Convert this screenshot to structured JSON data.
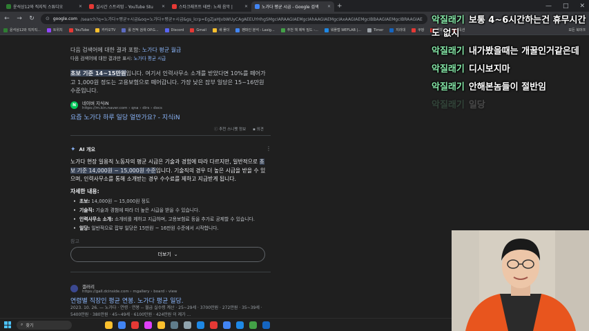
{
  "tabs": [
    {
      "label": "윤석상12와 직지직 스튜디오",
      "color": "#2e7d32",
      "active": false
    },
    {
      "label": "실시간 스트리밍 - YouTube Stu",
      "color": "#e53935",
      "active": false
    },
    {
      "label": "스타크래프트 테란: 노래 음악 |",
      "color": "#e53935",
      "active": false
    },
    {
      "label": "노가다 평균 시급 - Google 검색",
      "color": "#4285f4",
      "active": true
    }
  ],
  "toolbar": {
    "host": "google.com",
    "path": "/search?q=노가다+평균+시급&oq=노가다+평균+시급&gs_lcrp=EgZjaHJvbWUyCAgAEEUYHhgSMgcIARAAGIAEMgcIAhAAGIAEMgcIAxAAGIAEMgcIBBAAGIAEMgcIBRAAGIAEMgcIBhAAGIAEMgcIBxAAGIAE"
  },
  "bookmarks": [
    {
      "label": "윤석상12와 직지직...",
      "color": "#2e7d32"
    },
    {
      "label": "트위치",
      "color": "#9146ff"
    },
    {
      "label": "YouTube",
      "color": "#e53935"
    },
    {
      "label": "카카오TV",
      "color": "#fbc02d"
    },
    {
      "label": "롤 전적 검색 OP.G...",
      "color": "#5c6bc0"
    },
    {
      "label": "Discord",
      "color": "#5865f2"
    },
    {
      "label": "Gmail",
      "color": "#e53935"
    },
    {
      "label": "새 폴더",
      "color": "#fbc02d"
    },
    {
      "label": "팬파인 분석 - Lasig...",
      "color": "#4285f4"
    },
    {
      "label": "추천 책 제작 빌드 -...",
      "color": "#43a047"
    },
    {
      "label": "워플랩 WEFLAB |...",
      "color": "#1e88e5"
    },
    {
      "label": "Timer",
      "color": "#9aa0a6"
    },
    {
      "label": "지라대",
      "color": "#1565c0"
    },
    {
      "label": "쿠팡",
      "color": "#e53935"
    },
    {
      "label": "롯데온",
      "color": "#e53935"
    },
    {
      "label": "옥션",
      "color": "#e53935"
    }
  ],
  "bookmarks_all": "모든 북마크",
  "results": {
    "correction_prefix": "다음 검색어에 대한 결과 포함:",
    "correction_query": "노가다 평균 월급",
    "original_prefix": "다음 검색어에 대한 결과만 표시:",
    "original_query": "노가다 평균 시급",
    "snippet": {
      "highlight": "초보 기준 14~15만원",
      "text": "입니다. 여기서 인력사무소 소개를 받았다면 10%를 떼어가고 1,000원 정도는 고용보험으로 떼어갑니다. 가장 낮은 잡부 일당은 15~16만원 수준입니다."
    },
    "source_name": "네이버 지식iN",
    "source_url": "https://m.kin.naver.com › qna › dirs › docs",
    "result_title": "요즘 노가다 하루 일당 얼만가요? - 지식iN",
    "feedback_1": "추천 스니펫 정보",
    "feedback_2": "의견",
    "ai_label": "AI 개요",
    "ai_text_1": "노가다 현장 일용직 노동자의 평균 시급은 기술과 경험에 따라 다르지만, 일반적으로",
    "ai_highlight": "초보 기준 14,000원 ~ 15,000원 수준",
    "ai_text_2": "입니다. 기술직의 경우 더 높은 시급을 받을 수 있으며, 인력사무소를 통해 소개받는 경우 수수료를 제하고 지급받게 됩니다.",
    "details_title": "자세한 내용:",
    "details": [
      {
        "label": "초보:",
        "text": " 14,000원 ~ 15,000원 정도"
      },
      {
        "label": "기술직:",
        "text": " 기술과 경험에 따라 더 높은 시급을 받을 수 있습니다."
      },
      {
        "label": "인력사무소 소개:",
        "text": " 소개비를 제하고 지급하며, 고용보험료 등을 추가로 공제할 수 있습니다."
      },
      {
        "label": "일당:",
        "text": " 일반적으로 잡부 일당은 15만원 ~ 16만원 수준에서 시작합니다."
      }
    ],
    "faded_label": "참고",
    "more_label": "더보기",
    "gallery_name": "갤러리",
    "gallery_url": "https://gall.dcinside.com › mgallery › board › view",
    "gallery_title": "연령별 직장인 평균 연봉. 노가다 평균 일당.",
    "gallery_snippet": "2023. 10. 26. — 노가다 · 연령 · 연봉 -- 월급 실수령 계산 · 25~29세 · 3700만원 · 272만원 · 35~39세 · 5400만원 · 380만원 · 45~49세 · 6100만원 · 424만원 이 제가 ..."
  },
  "chat": [
    {
      "nick": "악질래기",
      "text": "보통 4~6시간하는건 휴무시간도 없지",
      "faded": false
    },
    {
      "nick": "악질래기",
      "text": "내가봤을때는 개꿀인거같은데",
      "faded": false
    },
    {
      "nick": "악질래기",
      "text": "디시보지마",
      "faded": false
    },
    {
      "nick": "악질래기",
      "text": "안해본놈들이 절반임",
      "faded": false
    },
    {
      "nick": "악질래기",
      "text": "일당",
      "faded": true
    }
  ],
  "taskbar": {
    "search_label": "찾기",
    "icons": [
      "#fbc02d",
      "#4285f4",
      "#e53935",
      "#e040fb",
      "#fbc02d",
      "#607d8b",
      "#90a4ae",
      "#1e88e5",
      "#e53935",
      "#4285f4",
      "#1e88e5",
      "#43a047",
      "#1565c0"
    ]
  },
  "colors": {
    "accent": "#8ab4f8",
    "chat_nick": "#86e8a8"
  }
}
